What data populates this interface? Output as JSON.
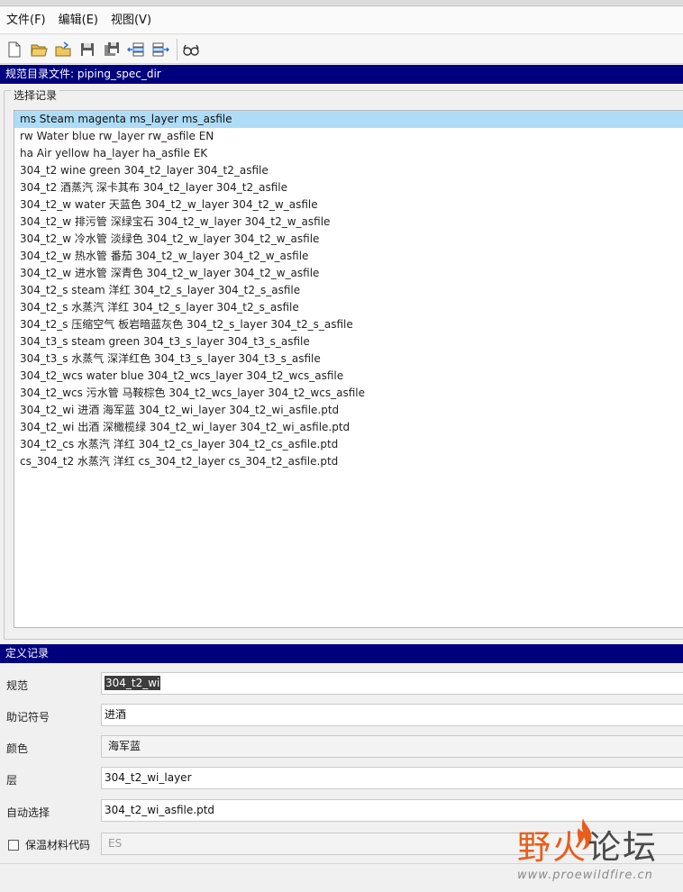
{
  "menu": [
    "文件(F)",
    "编辑(E)",
    "视图(V)"
  ],
  "toolbar": {
    "icons": [
      "new-file-icon",
      "open-folder-icon",
      "open-recent-icon",
      "save-icon",
      "save-as-icon",
      "move-row-left-icon",
      "move-row-right-icon",
      "glasses-icon"
    ]
  },
  "header": {
    "title": "规范目录文件: piping_spec_dir"
  },
  "select_group": {
    "legend": "选择记录"
  },
  "records": [
    "ms Steam magenta ms_layer ms_asfile",
    "rw Water blue rw_layer rw_asfile EN",
    "ha Air yellow ha_layer ha_asfile EK",
    "304_t2 wine green 304_t2_layer 304_t2_asfile",
    "304_t2 酒蒸汽 深卡其布 304_t2_layer 304_t2_asfile",
    "304_t2_w water 天蓝色 304_t2_w_layer 304_t2_w_asfile",
    "304_t2_w 排污管 深绿宝石 304_t2_w_layer 304_t2_w_asfile",
    "304_t2_w 冷水管 淡绿色 304_t2_w_layer 304_t2_w_asfile",
    "304_t2_w 热水管 番茄 304_t2_w_layer 304_t2_w_asfile",
    "304_t2_w 进水管 深青色 304_t2_w_layer 304_t2_w_asfile",
    "304_t2_s steam 洋红 304_t2_s_layer 304_t2_s_asfile",
    "304_t2_s 水蒸汽 洋红 304_t2_s_layer 304_t2_s_asfile",
    "304_t2_s 压缩空气 板岩暗蓝灰色 304_t2_s_layer 304_t2_s_asfile",
    "304_t3_s steam green 304_t3_s_layer 304_t3_s_asfile",
    "304_t3_s 水蒸气 深洋红色 304_t3_s_layer 304_t3_s_asfile",
    "304_t2_wcs water blue 304_t2_wcs_layer 304_t2_wcs_asfile",
    "304_t2_wcs 污水管 马鞍棕色 304_t2_wcs_layer 304_t2_wcs_asfile",
    "304_t2_wi 进酒 海军蓝 304_t2_wi_layer 304_t2_wi_asfile.ptd",
    "304_t2_wi 出酒 深橄榄绿 304_t2_wi_layer 304_t2_wi_asfile.ptd",
    "304_t2_cs 水蒸汽 洋红 304_t2_cs_layer 304_t2_cs_asfile.ptd",
    "cs_304_t2 水蒸汽 洋红 cs_304_t2_layer cs_304_t2_asfile.ptd"
  ],
  "selected_record_index": 0,
  "define_section": {
    "title": "定义记录"
  },
  "form": {
    "spec": {
      "label": "规范",
      "value": "304_t2_wi"
    },
    "mnemonic": {
      "label": "助记符号",
      "value": "进酒"
    },
    "color": {
      "label": "颜色",
      "value": "海军蓝"
    },
    "layer": {
      "label": "层",
      "value": "304_t2_wi_layer"
    },
    "auto_select": {
      "label": "自动选择",
      "value": "304_t2_wi_asfile.ptd"
    },
    "insulation": {
      "label": "保温材料代码",
      "value": "ES",
      "checked": false
    }
  },
  "watermark": {
    "cn_part1": "野",
    "cn_part2": "火",
    "cn_part3": "论坛",
    "url": "www.proewildfire.cn"
  },
  "colors": {
    "title_bar": "#00007f",
    "selected_row": "#aedcf6",
    "accent": "#e85d1c"
  }
}
